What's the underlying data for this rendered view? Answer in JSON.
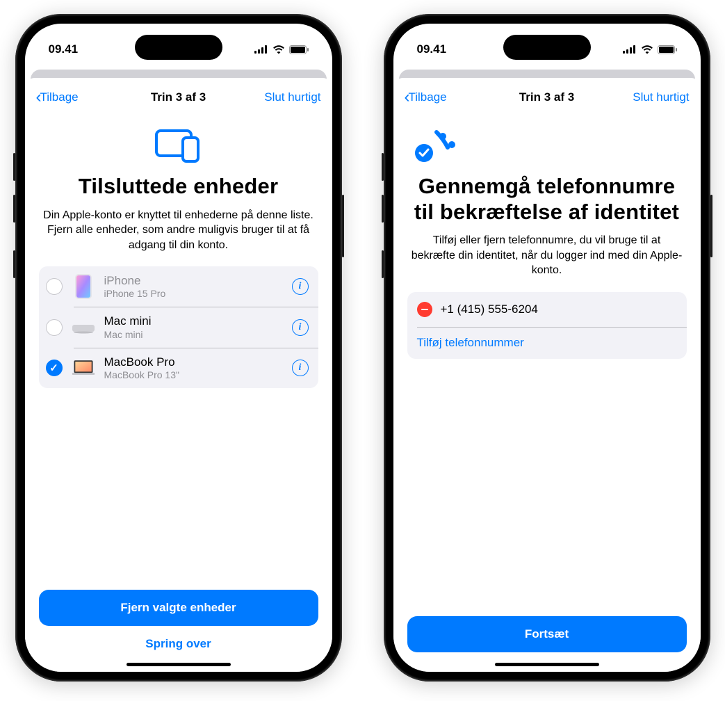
{
  "status": {
    "time": "09.41"
  },
  "nav": {
    "back": "Tilbage",
    "step": "Trin 3 af 3",
    "quick_exit": "Slut hurtigt"
  },
  "screens": {
    "devices": {
      "title": "Tilsluttede enheder",
      "desc": "Din Apple-konto er knyttet til enhederne på denne liste. Fjern alle enheder, som andre muligvis bruger til at få adgang til din konto.",
      "list": [
        {
          "name": "iPhone",
          "sub": "iPhone 15 Pro",
          "selected": false,
          "disabled": true
        },
        {
          "name": "Mac mini",
          "sub": "Mac mini",
          "selected": false,
          "disabled": false
        },
        {
          "name": "MacBook Pro",
          "sub": "MacBook Pro 13\"",
          "selected": true,
          "disabled": false
        }
      ],
      "primary": "Fjern valgte enheder",
      "secondary": "Spring over"
    },
    "phones": {
      "title": "Gennemgå telefonnumre til bekræftelse af identitet",
      "desc": "Tilføj eller fjern telefonnumre, du vil bruge til at bekræfte din identitet, når du logger ind med din Apple-konto.",
      "number": "+1 (415) 555-6204",
      "add_label": "Tilføj telefonnummer",
      "primary": "Fortsæt"
    }
  }
}
